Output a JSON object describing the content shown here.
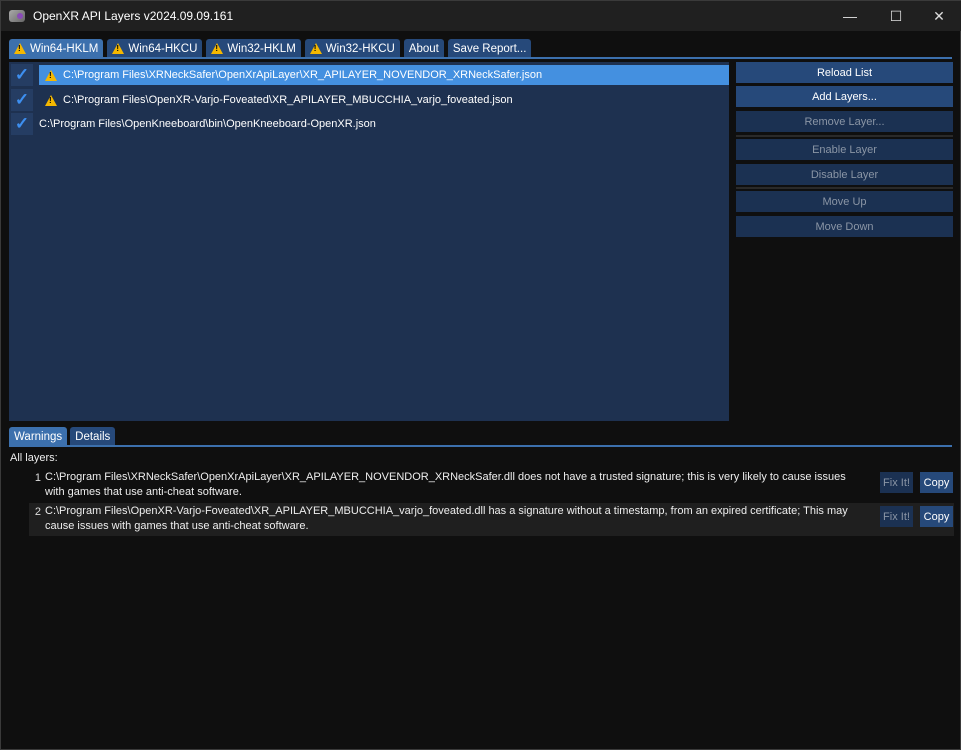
{
  "window": {
    "title": "OpenXR API Layers v2024.09.09.161",
    "minimize": "—",
    "maximize": "☐",
    "close": "✕"
  },
  "tabs": [
    {
      "label": "Win64-HKLM",
      "warning": true
    },
    {
      "label": "Win64-HKCU",
      "warning": true
    },
    {
      "label": "Win32-HKLM",
      "warning": true
    },
    {
      "label": "Win32-HKCU",
      "warning": true
    },
    {
      "label": "About",
      "warning": false
    },
    {
      "label": "Save Report...",
      "warning": false
    }
  ],
  "layers": [
    {
      "path": "C:\\Program Files\\XRNeckSafer\\OpenXrApiLayer\\XR_APILAYER_NOVENDOR_XRNeckSafer.json",
      "enabled": true,
      "warning": true,
      "selected": true
    },
    {
      "path": "C:\\Program Files\\OpenXR-Varjo-Foveated\\XR_APILAYER_MBUCCHIA_varjo_foveated.json",
      "enabled": true,
      "warning": true,
      "selected": false
    },
    {
      "path": "C:\\Program Files\\OpenKneeboard\\bin\\OpenKneeboard-OpenXR.json",
      "enabled": true,
      "warning": false,
      "selected": false
    }
  ],
  "actions": {
    "reload": "Reload List",
    "add": "Add Layers...",
    "remove": "Remove Layer...",
    "enable": "Enable Layer",
    "disable": "Disable Layer",
    "up": "Move Up",
    "down": "Move Down"
  },
  "bottom_tabs": {
    "warnings": "Warnings",
    "details": "Details"
  },
  "warnings": {
    "heading": "All layers:",
    "fix_label": "Fix It!",
    "copy_label": "Copy",
    "items": [
      {
        "num": "1",
        "text": "C:\\Program Files\\XRNeckSafer\\OpenXrApiLayer\\XR_APILAYER_NOVENDOR_XRNeckSafer.dll does not have a trusted signature; this is very likely to cause issues with games that use anti-cheat software."
      },
      {
        "num": "2",
        "text": "C:\\Program Files\\OpenXR-Varjo-Foveated\\XR_APILAYER_MBUCCHIA_varjo_foveated.dll has a signature without a timestamp, from an expired certificate; This may cause issues with games that use anti-cheat software."
      }
    ]
  },
  "colors": {
    "accent": "#3c70ad",
    "selected": "#4490e0",
    "list_bg": "#1e3150",
    "warning": "#f5b800"
  }
}
